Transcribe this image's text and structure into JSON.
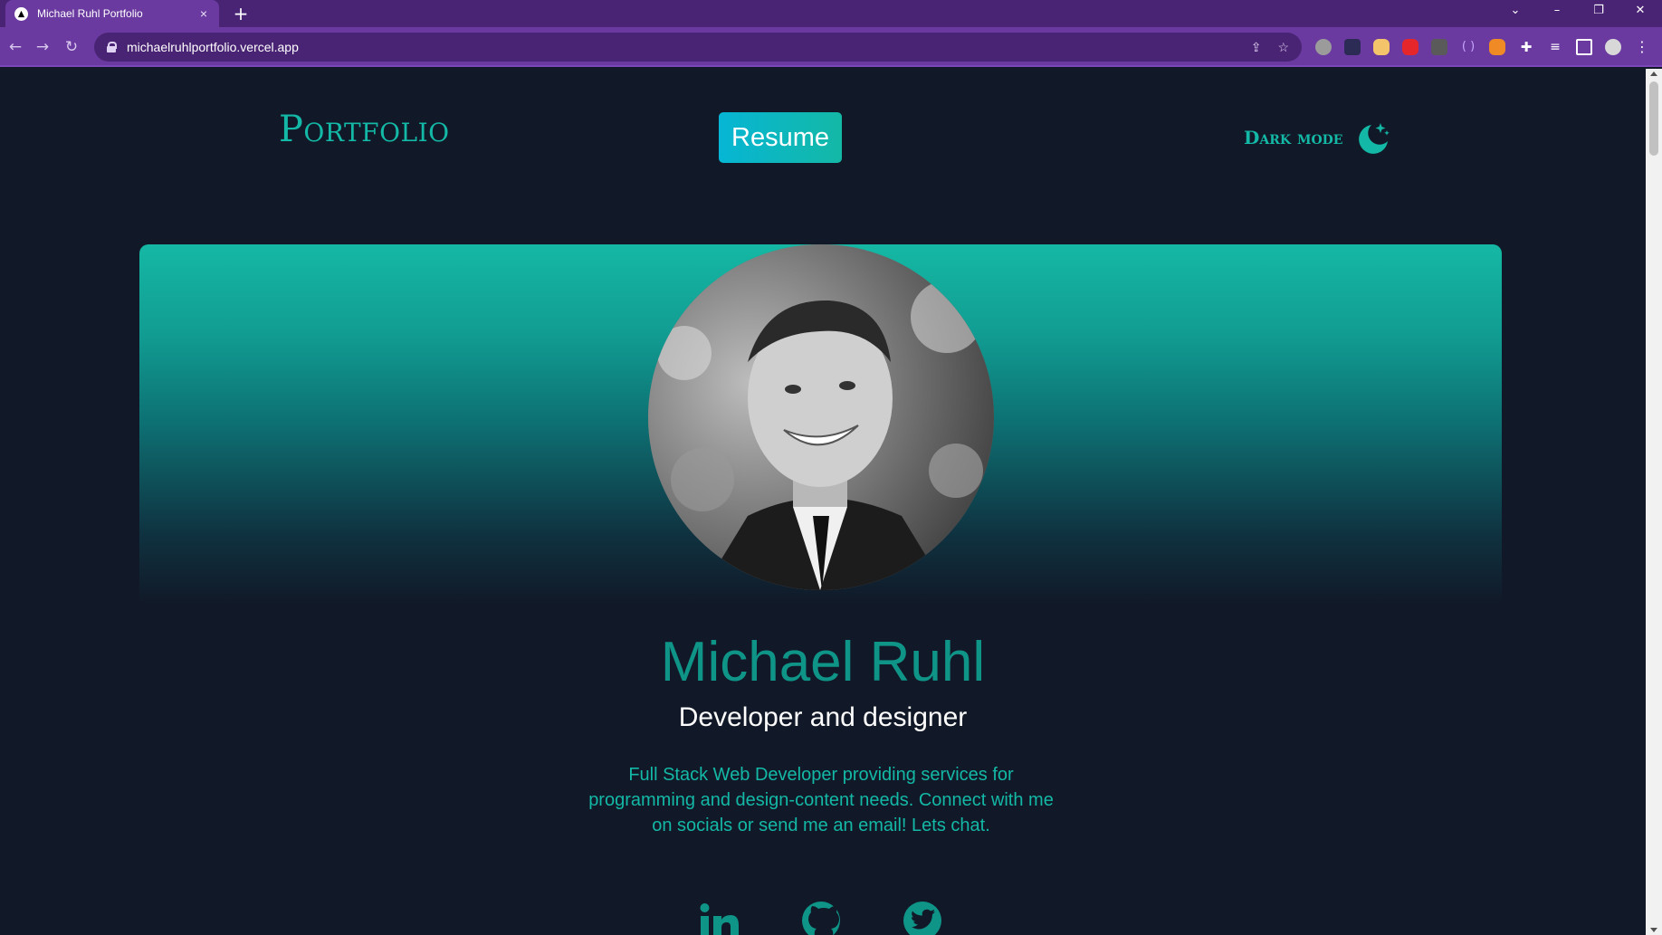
{
  "browser": {
    "tab_title": "Michael Ruhl Portfolio",
    "url": "michaelruhlportfolio.vercel.app"
  },
  "nav": {
    "brand": "Portfolio",
    "resume_label": "Resume",
    "dark_mode_label": "Dark mode"
  },
  "profile": {
    "name": "Michael Ruhl",
    "role": "Developer and designer",
    "bio": "Full Stack Web Developer providing services for programming and design-content needs. Connect with me on socials or send me an email! Lets chat."
  },
  "socials": [
    {
      "icon": "linkedin-icon"
    },
    {
      "icon": "github-icon"
    },
    {
      "icon": "twitter-icon"
    }
  ],
  "colors": {
    "page_bg": "#111827",
    "accent": "#14b8a6",
    "browser_frame": "#6a3aa0"
  }
}
